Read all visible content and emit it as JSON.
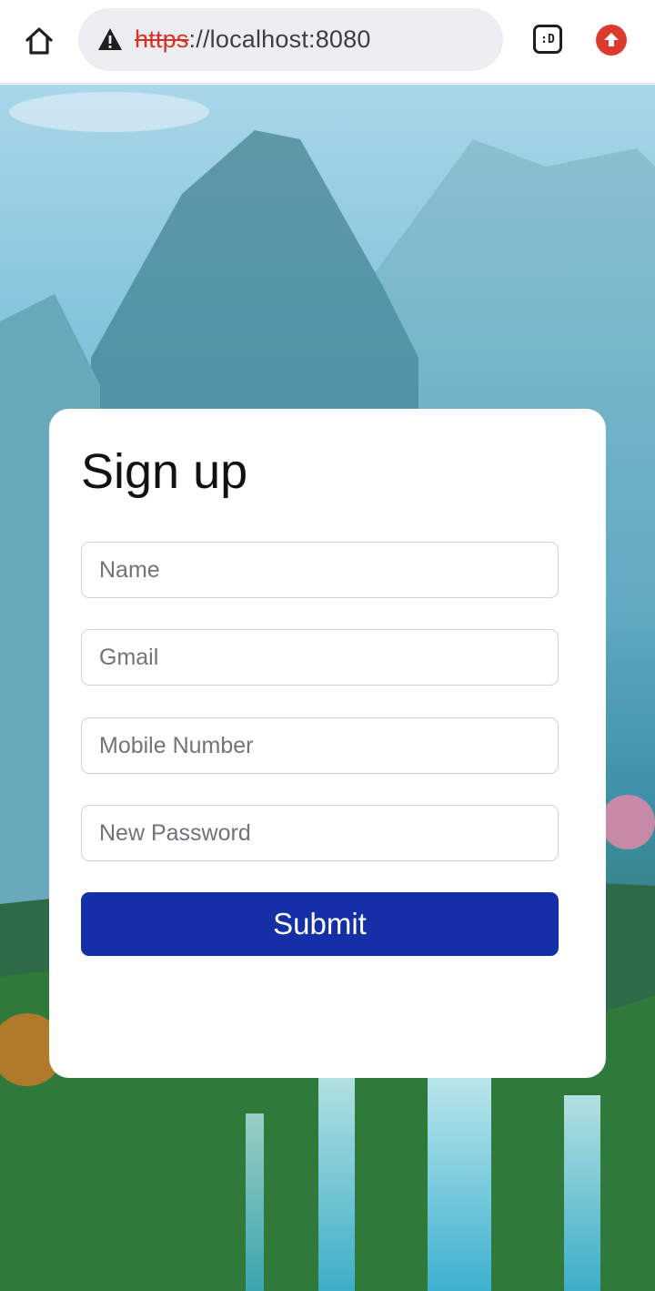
{
  "browser": {
    "home_icon": "home-icon",
    "warning_icon": "warning-triangle-icon",
    "url_scheme": "https",
    "url_rest": "://localhost:8080",
    "tab_label": ":D",
    "update_icon": "arrow-up-icon"
  },
  "form": {
    "title": "Sign up",
    "fields": [
      {
        "placeholder": "Name",
        "value": ""
      },
      {
        "placeholder": "Gmail",
        "value": ""
      },
      {
        "placeholder": "Mobile Number",
        "value": ""
      },
      {
        "placeholder": "New Password",
        "value": ""
      }
    ],
    "submit_label": "Submit"
  },
  "colors": {
    "accent": "#1530a6",
    "warning": "#d93025",
    "update": "#dd3a2e"
  }
}
